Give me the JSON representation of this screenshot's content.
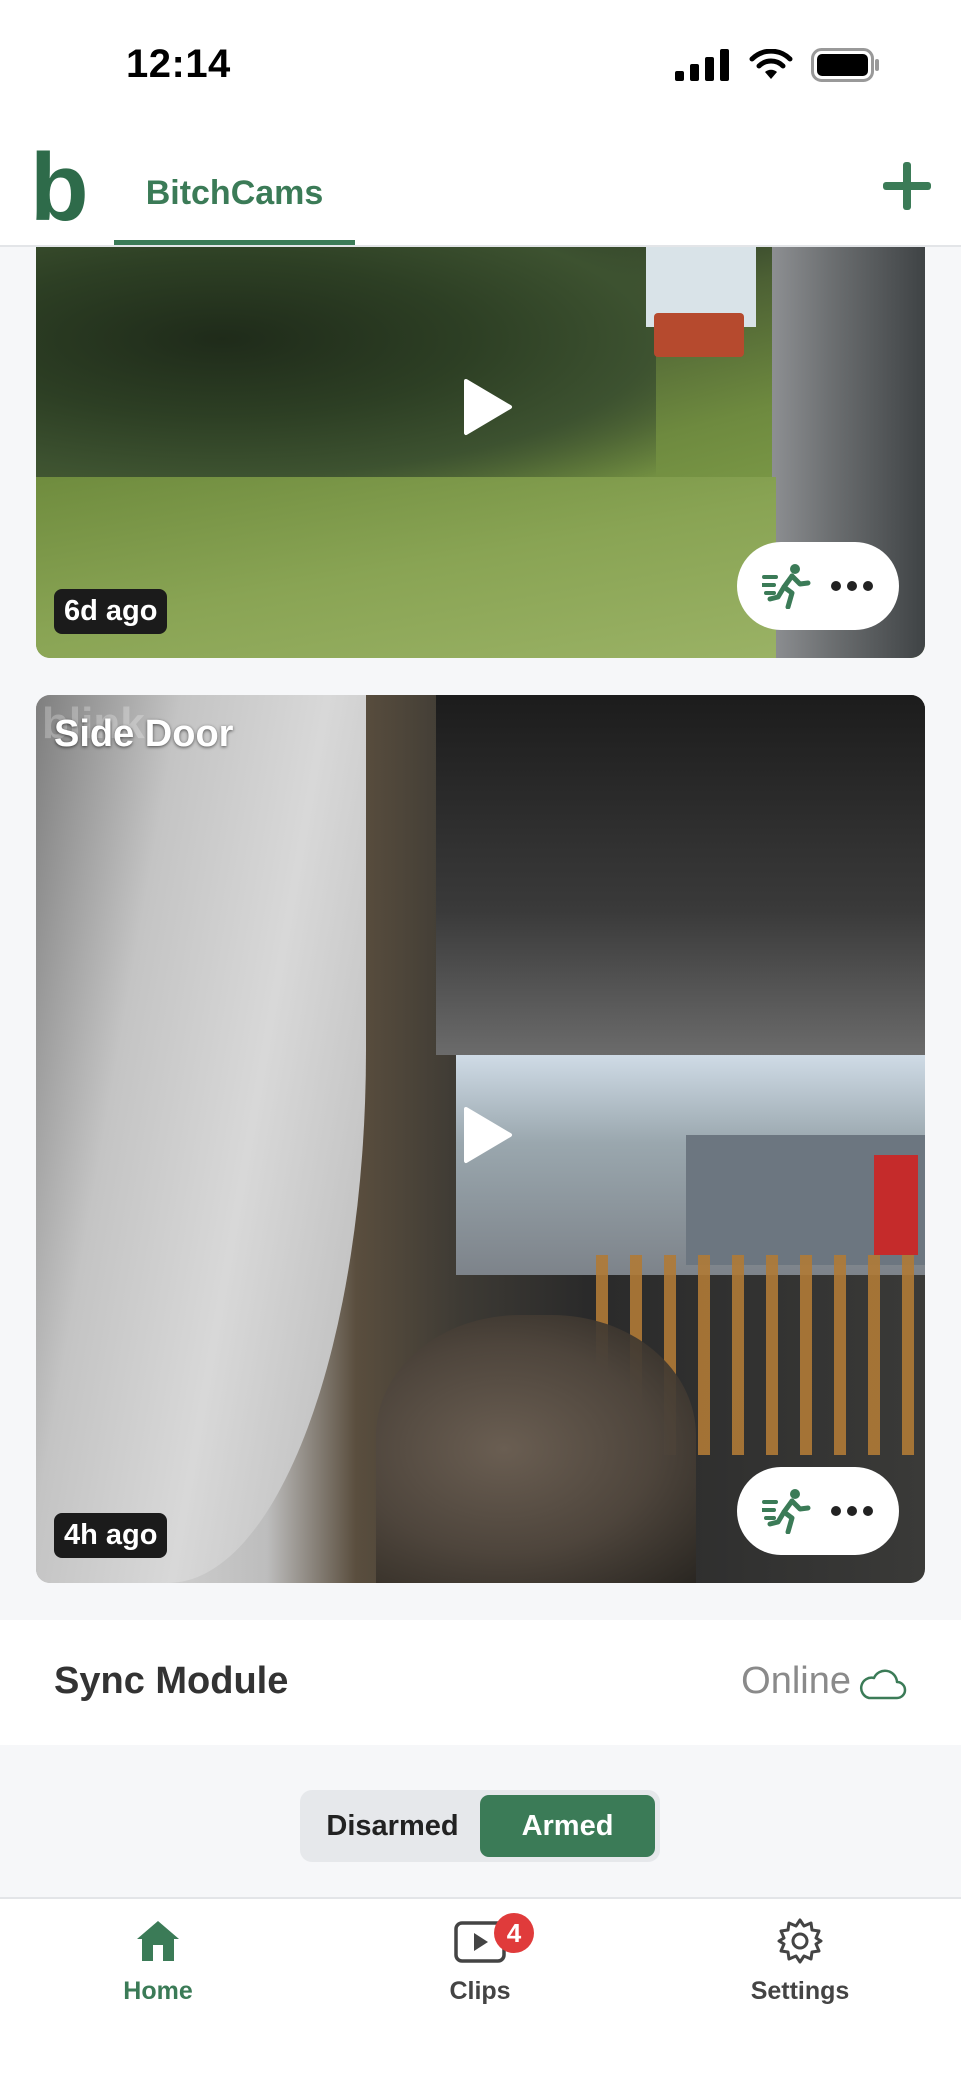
{
  "status_bar": {
    "time": "12:14"
  },
  "header": {
    "logo": "b",
    "tab_label": "BitchCams",
    "add_button": "+"
  },
  "cameras": [
    {
      "name": "",
      "last_clip": "6d ago"
    },
    {
      "name": "Side Door",
      "watermark": "blink",
      "last_clip": "4h ago"
    }
  ],
  "sync_module": {
    "title": "Sync Module",
    "status": "Online"
  },
  "arm_toggle": {
    "disarmed_label": "Disarmed",
    "armed_label": "Armed",
    "selected": "Armed"
  },
  "bottom_nav": {
    "home_label": "Home",
    "clips_label": "Clips",
    "clips_badge": "4",
    "settings_label": "Settings"
  },
  "colors": {
    "accent": "#3b7b57",
    "badge": "#e03b3b"
  }
}
